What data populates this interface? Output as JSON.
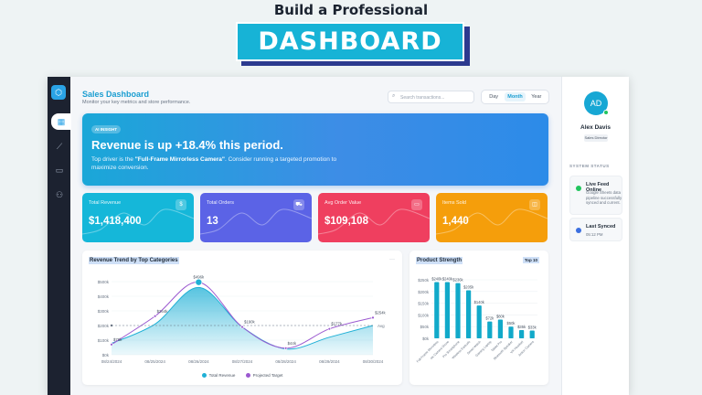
{
  "hero": {
    "title": "Build a Professional",
    "badge": "DASHBOARD"
  },
  "rail": {
    "logo_icon": "hexagon-icon",
    "items": [
      "dashboard-icon",
      "trend-icon",
      "folder-icon",
      "users-icon"
    ]
  },
  "header": {
    "title": "Sales Dashboard",
    "subtitle": "Monitor your key metrics and store performance.",
    "search_placeholder": "Search transactions...",
    "ranges": [
      "Day",
      "Month",
      "Year"
    ],
    "active_range": "Month"
  },
  "insight": {
    "tag": "AI INSIGHT",
    "headline": "Revenue is up +18.4% this period.",
    "text_pre": "Top driver is the ",
    "text_product": "\"Full-Frame Mirrorless Camera\"",
    "text_post": ". Consider running a targeted promotion to maximize conversion."
  },
  "kpis": [
    {
      "label": "Total Revenue",
      "value": "$1,418,400",
      "icon": "dollar-icon",
      "color": "#15b7d9"
    },
    {
      "label": "Total Orders",
      "value": "13",
      "icon": "cart-icon",
      "color": "#5b63e6"
    },
    {
      "label": "Avg Order Value",
      "value": "$109,108",
      "icon": "card-icon",
      "color": "#ef3f5f"
    },
    {
      "label": "Items Sold",
      "value": "1,440",
      "icon": "box-icon",
      "color": "#f59e0b"
    }
  ],
  "revenue_panel": {
    "title": "Revenue Trend by Top Categories",
    "menu": "···",
    "legend": [
      "Total Revenue",
      "Projected Target"
    ],
    "avg_label": "Avg"
  },
  "strength_panel": {
    "title": "Product Strength",
    "pill": "Top 10"
  },
  "sidebar": {
    "initials": "AD",
    "name": "Alex Davis",
    "role": "Sales Director",
    "status_heading": "SYSTEM STATUS",
    "cards": [
      {
        "title": "Live Feed Online",
        "text": "Google Sheets data pipeline successfully synced and current."
      },
      {
        "title": "Last Synced",
        "text": "05:12 PM"
      }
    ]
  },
  "colors": {
    "accent": "#1b9ed1",
    "revenue": "#1fb0d6",
    "target": "#9b59d0",
    "bar": "#11a9c9"
  },
  "chart_data": [
    {
      "type": "area",
      "title": "Revenue Trend by Top Categories",
      "x": [
        "08/24/2024",
        "08/25/2024",
        "08/26/2024",
        "08/27/2024",
        "08/28/2024",
        "08/29/2024",
        "08/30/2024"
      ],
      "series": [
        {
          "name": "Total Revenue",
          "values": [
            78000,
            210000,
            460000,
            190000,
            40000,
            120000,
            200000
          ]
        },
        {
          "name": "Projected Target",
          "values": [
            70000,
            264000,
            496000,
            190000,
            45000,
            177000,
            254000
          ]
        }
      ],
      "avg_line": 200000,
      "data_labels": [
        "$78k",
        "$264k",
        "$496k",
        "$190k",
        "$44k",
        "$177k",
        "$254k"
      ],
      "yticks": [
        "$0k",
        "$100k",
        "$200k",
        "$300k",
        "$400k",
        "$500k"
      ],
      "ylim": [
        0,
        500000
      ],
      "grid": true,
      "legend": "bottom"
    },
    {
      "type": "bar",
      "title": "Product Strength",
      "categories": [
        "Full-Frame Mirrorless",
        "4K Camera Drone",
        "Pro Smartphone",
        "Wireless Earbuds",
        "Smart Watch",
        "Gaming Laptop",
        "Tablet Pro",
        "Bluetooth Speaker",
        "VR Headset",
        "Action Camera"
      ],
      "values": [
        240,
        240,
        236,
        205,
        140,
        72,
        80,
        50,
        35,
        33
      ],
      "data_labels": [
        "$240k",
        "$240k",
        "$236k",
        "$205k",
        "$140k",
        "$72k",
        "$80k",
        "$50k",
        "$35k",
        "$33k"
      ],
      "yticks": [
        "$0k",
        "$50k",
        "$100k",
        "$150k",
        "$200k",
        "$250k"
      ],
      "ylim": [
        0,
        250
      ],
      "grid": true
    }
  ]
}
